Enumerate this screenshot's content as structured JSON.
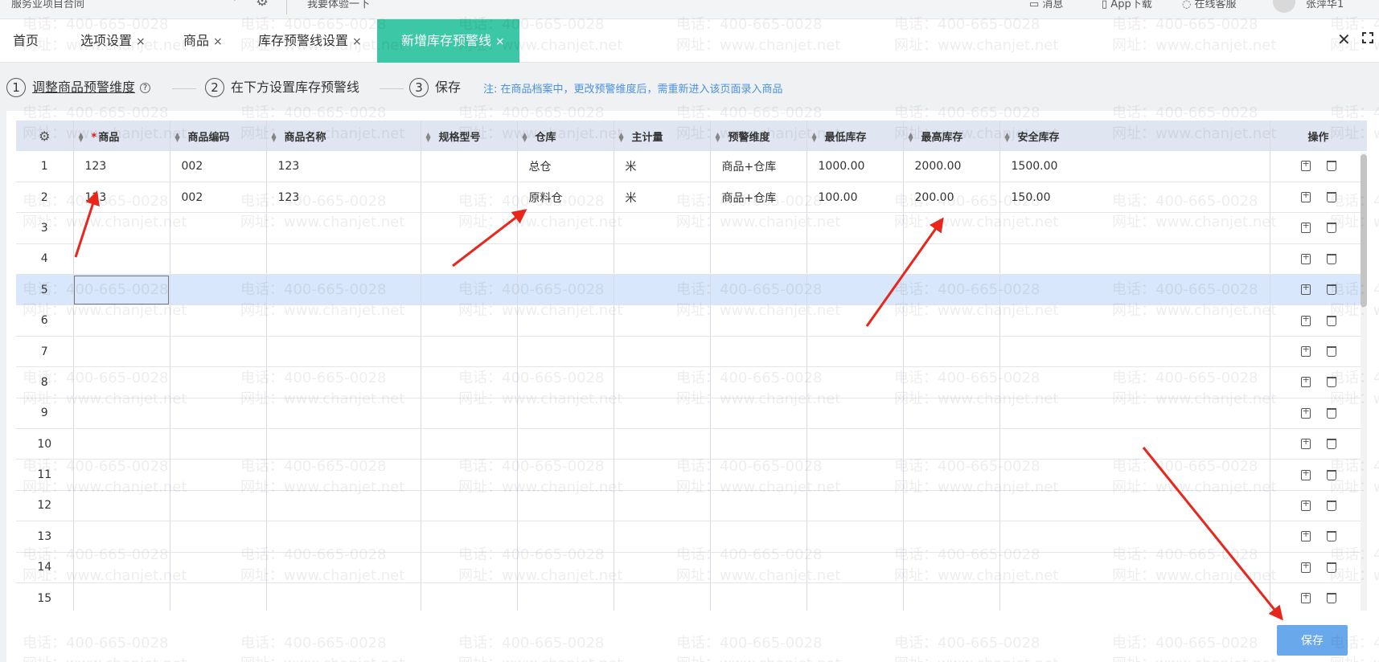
{
  "topbar": {
    "company": "服务业项目合同",
    "experience": "我要体验一下",
    "messages": "消息",
    "app_download": "App下载",
    "online_service": "在线客服",
    "user": "张萍华1"
  },
  "tabs": [
    {
      "label": "首页"
    },
    {
      "label": "选项设置",
      "close": "×"
    },
    {
      "label": "商品",
      "close": "×"
    },
    {
      "label": "库存预警线设置",
      "close": "×"
    },
    {
      "label": "新增库存预警线",
      "close": "×",
      "active": true
    }
  ],
  "steps": [
    {
      "num": "1",
      "label": "调整商品预警维度"
    },
    {
      "num": "2",
      "label": "在下方设置库存预警线"
    },
    {
      "num": "3",
      "label": "保存"
    }
  ],
  "note": "注: 在商品档案中，更改预警维度后，需重新进入该页面录入商品",
  "table": {
    "columns": [
      "商品",
      "商品编码",
      "商品名称",
      "规格型号",
      "仓库",
      "主计量",
      "预警维度",
      "最低库存",
      "最高库存",
      "安全库存",
      "操作"
    ],
    "required_mark": "*",
    "rows": [
      [
        "1",
        "123",
        "002",
        "123",
        "",
        "总仓",
        "米",
        "商品+仓库",
        "1000.00",
        "2000.00",
        "1500.00"
      ],
      [
        "2",
        "123",
        "002",
        "123",
        "",
        "原料仓",
        "米",
        "商品+仓库",
        "100.00",
        "200.00",
        "150.00"
      ],
      [
        "3",
        "",
        "",
        "",
        "",
        "",
        "",
        "",
        "",
        "",
        ""
      ],
      [
        "4",
        "",
        "",
        "",
        "",
        "",
        "",
        "",
        "",
        "",
        ""
      ],
      [
        "5",
        "",
        "",
        "",
        "",
        "",
        "",
        "",
        "",
        "",
        ""
      ],
      [
        "6",
        "",
        "",
        "",
        "",
        "",
        "",
        "",
        "",
        "",
        ""
      ],
      [
        "7",
        "",
        "",
        "",
        "",
        "",
        "",
        "",
        "",
        "",
        ""
      ],
      [
        "8",
        "",
        "",
        "",
        "",
        "",
        "",
        "",
        "",
        "",
        ""
      ],
      [
        "9",
        "",
        "",
        "",
        "",
        "",
        "",
        "",
        "",
        "",
        ""
      ],
      [
        "10",
        "",
        "",
        "",
        "",
        "",
        "",
        "",
        "",
        "",
        ""
      ],
      [
        "11",
        "",
        "",
        "",
        "",
        "",
        "",
        "",
        "",
        "",
        ""
      ],
      [
        "12",
        "",
        "",
        "",
        "",
        "",
        "",
        "",
        "",
        "",
        ""
      ],
      [
        "13",
        "",
        "",
        "",
        "",
        "",
        "",
        "",
        "",
        "",
        ""
      ],
      [
        "14",
        "",
        "",
        "",
        "",
        "",
        "",
        "",
        "",
        "",
        ""
      ],
      [
        "15",
        "",
        "",
        "",
        "",
        "",
        "",
        "",
        "",
        "",
        ""
      ]
    ],
    "selected_row": 5
  },
  "save_label": "保存",
  "watermark": {
    "phone": "电话：400-665-0028",
    "site": "网址：www.chanjet.net"
  },
  "colors": {
    "active_tab": "#3cc8a6",
    "header_bg": "#dfe6f2",
    "selected_row": "#d8e7fb",
    "save_button": "#6aa8ec",
    "note": "#4a90e2",
    "annotation_arrow": "#e8261c"
  },
  "icons": [
    "settings-gear-icon",
    "sort-icon",
    "help-icon",
    "copy-row-icon",
    "delete-row-icon",
    "close-all-tabs-icon",
    "fullscreen-icon",
    "message-icon",
    "phone-icon",
    "headset-icon"
  ]
}
